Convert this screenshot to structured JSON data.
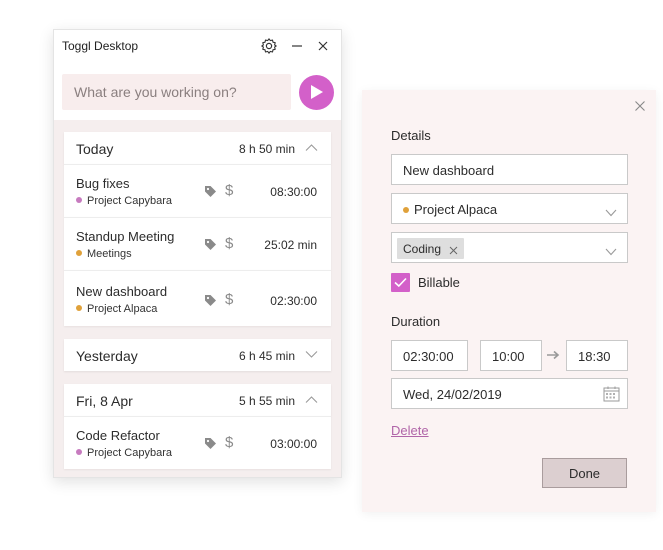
{
  "window": {
    "title": "Toggl Desktop"
  },
  "timer": {
    "placeholder": "What are you working on?"
  },
  "groups": [
    {
      "title": "Today",
      "total": "8 h 50 min",
      "entries": [
        {
          "description": "Bug fixes",
          "project": "Project Capybara",
          "project_color": "#c77bbf",
          "duration": "08:30:00"
        },
        {
          "description": "Standup Meeting",
          "project": "Meetings",
          "project_color": "#e0a13a",
          "duration": "25:02 min"
        },
        {
          "description": "New dashboard",
          "project": "Project Alpaca",
          "project_color": "#e0a13a",
          "duration": "02:30:00"
        }
      ]
    },
    {
      "title": "Yesterday",
      "total": "6 h 45 min",
      "entries": []
    },
    {
      "title": "Fri, 8 Apr",
      "total": "5 h 55 min",
      "entries": [
        {
          "description": "Code Refactor",
          "project": "Project Capybara",
          "project_color": "#c77bbf",
          "duration": "03:00:00"
        }
      ]
    }
  ],
  "details": {
    "section_label": "Details",
    "description": "New dashboard",
    "project": "Project Alpaca",
    "project_color": "#e0a13a",
    "tag": "Coding",
    "billable_label": "Billable",
    "billable_checked": true,
    "duration_label": "Duration",
    "duration": "02:30:00",
    "start": "10:00",
    "end": "18:30",
    "date": "Wed, 24/02/2019",
    "delete_label": "Delete",
    "done_label": "Done"
  },
  "colors": {
    "accent": "#d360c9",
    "list_background": "#f5eeee",
    "panel_background": "#fbf3f3"
  }
}
